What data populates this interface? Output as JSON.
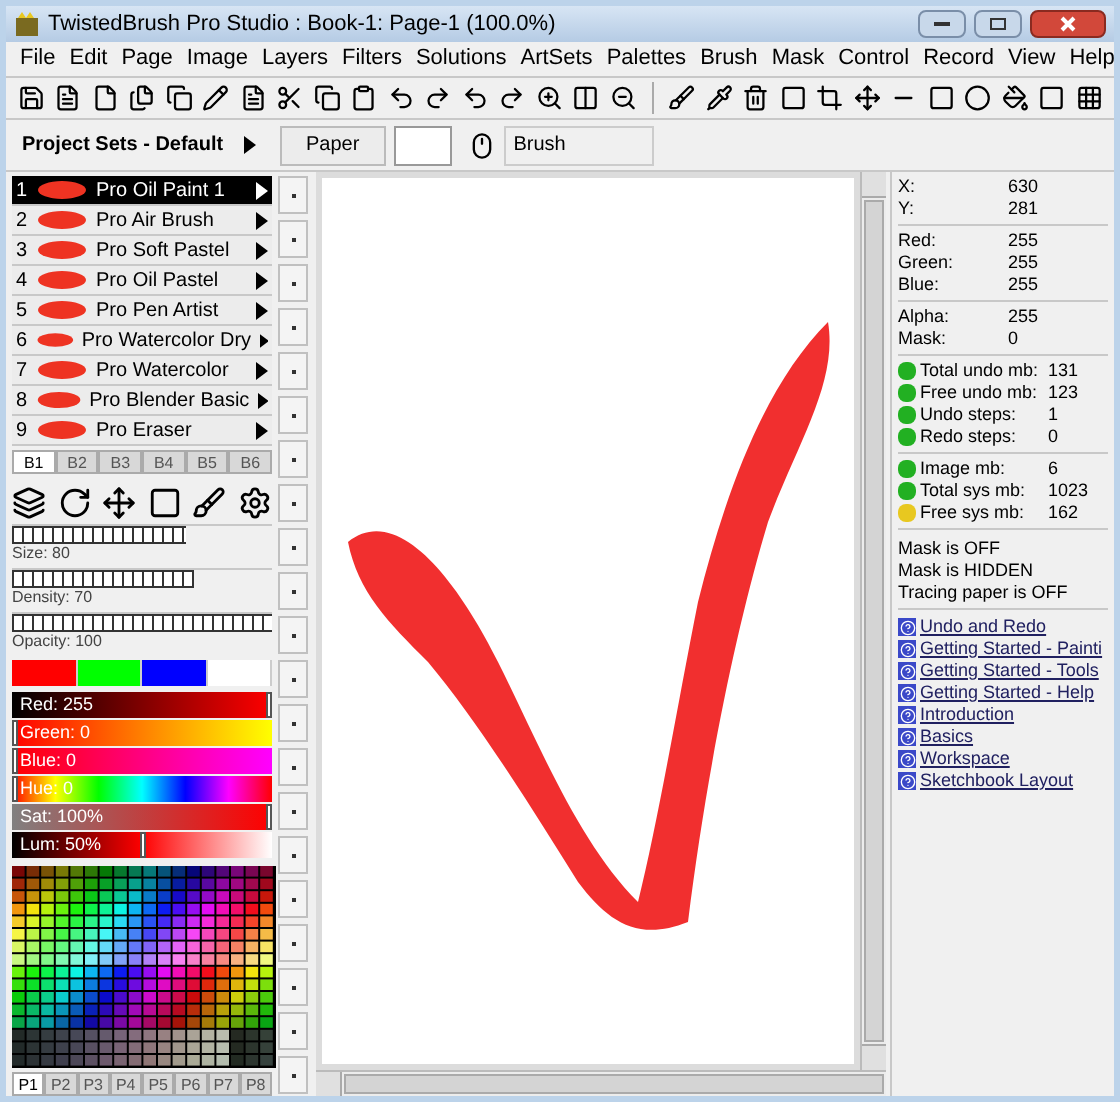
{
  "window": {
    "title": "TwistedBrush Pro Studio : Book-1: Page-1 (100.0%)"
  },
  "menu": [
    "File",
    "Edit",
    "Page",
    "Image",
    "Layers",
    "Filters",
    "Solutions",
    "ArtSets",
    "Palettes",
    "Brush",
    "Mask",
    "Control",
    "Record",
    "View",
    "Help"
  ],
  "header": {
    "project_sets": "Project Sets - Default",
    "paper_button": "Paper",
    "brush_label": "Brush"
  },
  "brushes": [
    {
      "number": "1",
      "name": "Pro Oil Paint 1",
      "selected": true
    },
    {
      "number": "2",
      "name": "Pro Air Brush",
      "selected": false
    },
    {
      "number": "3",
      "name": "Pro Soft Pastel",
      "selected": false
    },
    {
      "number": "4",
      "name": "Pro Oil Pastel",
      "selected": false
    },
    {
      "number": "5",
      "name": "Pro Pen Artist",
      "selected": false
    },
    {
      "number": "6",
      "name": "Pro Watercolor Dry",
      "selected": false
    },
    {
      "number": "7",
      "name": "Pro Watercolor",
      "selected": false
    },
    {
      "number": "8",
      "name": "Pro Blender Basic",
      "selected": false
    },
    {
      "number": "9",
      "name": "Pro Eraser",
      "selected": false
    }
  ],
  "brush_tabs": [
    {
      "label": "B1",
      "selected": true
    },
    {
      "label": "B2",
      "selected": false
    },
    {
      "label": "B3",
      "selected": false
    },
    {
      "label": "B4",
      "selected": false
    },
    {
      "label": "B5",
      "selected": false
    },
    {
      "label": "B6",
      "selected": false
    }
  ],
  "sliders": [
    {
      "label": "Size: 80",
      "level": 0.67
    },
    {
      "label": "Density: 70",
      "level": 0.7
    },
    {
      "label": "Opacity: 100",
      "level": 1
    }
  ],
  "swatches": [
    {
      "color": "#ff0000"
    },
    {
      "color": "#00ff00"
    },
    {
      "color": "#0000ff"
    },
    {
      "color": "#ffffff"
    }
  ],
  "color_bars": [
    {
      "kind": "red",
      "label": "Red: 255",
      "level": 1
    },
    {
      "kind": "green",
      "label": "Green: 0",
      "level": 0
    },
    {
      "kind": "blue",
      "label": "Blue: 0",
      "level": 0
    },
    {
      "kind": "hue",
      "label": "Hue: 0",
      "level": 0
    },
    {
      "kind": "sat",
      "label": "Sat: 100%",
      "level": 1
    },
    {
      "kind": "lum",
      "label": "Lum: 50%",
      "level": 0.5
    }
  ],
  "palette_tabs": [
    {
      "label": "P1",
      "selected": true
    },
    {
      "label": "P2",
      "selected": false
    },
    {
      "label": "P3",
      "selected": false
    },
    {
      "label": "P4",
      "selected": false
    },
    {
      "label": "P5",
      "selected": false
    },
    {
      "label": "P6",
      "selected": false
    },
    {
      "label": "P7",
      "selected": false
    },
    {
      "label": "P8",
      "selected": false
    }
  ],
  "info_groups": [
    [
      {
        "label": "X:",
        "value": "630"
      },
      {
        "label": "Y:",
        "value": "281"
      }
    ],
    [
      {
        "label": "Red:",
        "value": "255"
      },
      {
        "label": "Green:",
        "value": "255"
      },
      {
        "label": "Blue:",
        "value": "255"
      }
    ],
    [
      {
        "label": "Alpha:",
        "value": "255"
      },
      {
        "label": "Mask:",
        "value": "0"
      }
    ]
  ],
  "memory_groups": [
    [
      {
        "label": "Total undo mb:",
        "value": "131",
        "color": "#22b022"
      },
      {
        "label": "Free undo mb:",
        "value": "123",
        "color": "#22b022"
      },
      {
        "label": "Undo steps:",
        "value": "1",
        "color": "#22b022"
      },
      {
        "label": "Redo steps:",
        "value": "0",
        "color": "#22b022"
      }
    ],
    [
      {
        "label": "Image mb:",
        "value": "6",
        "color": "#22b022"
      },
      {
        "label": "Total sys mb:",
        "value": "1023",
        "color": "#22b022"
      },
      {
        "label": "Free sys mb:",
        "value": "162",
        "color": "#e8c820"
      }
    ]
  ],
  "flags": [
    "Mask is OFF",
    "Mask is HIDDEN",
    "Tracing paper is OFF"
  ],
  "help_links": [
    "Undo and Redo",
    "Getting Started - Painti",
    "Getting Started - Tools",
    "Getting Started - Help",
    "Introduction",
    "Basics",
    "Workspace",
    "Sketchbook Layout"
  ]
}
